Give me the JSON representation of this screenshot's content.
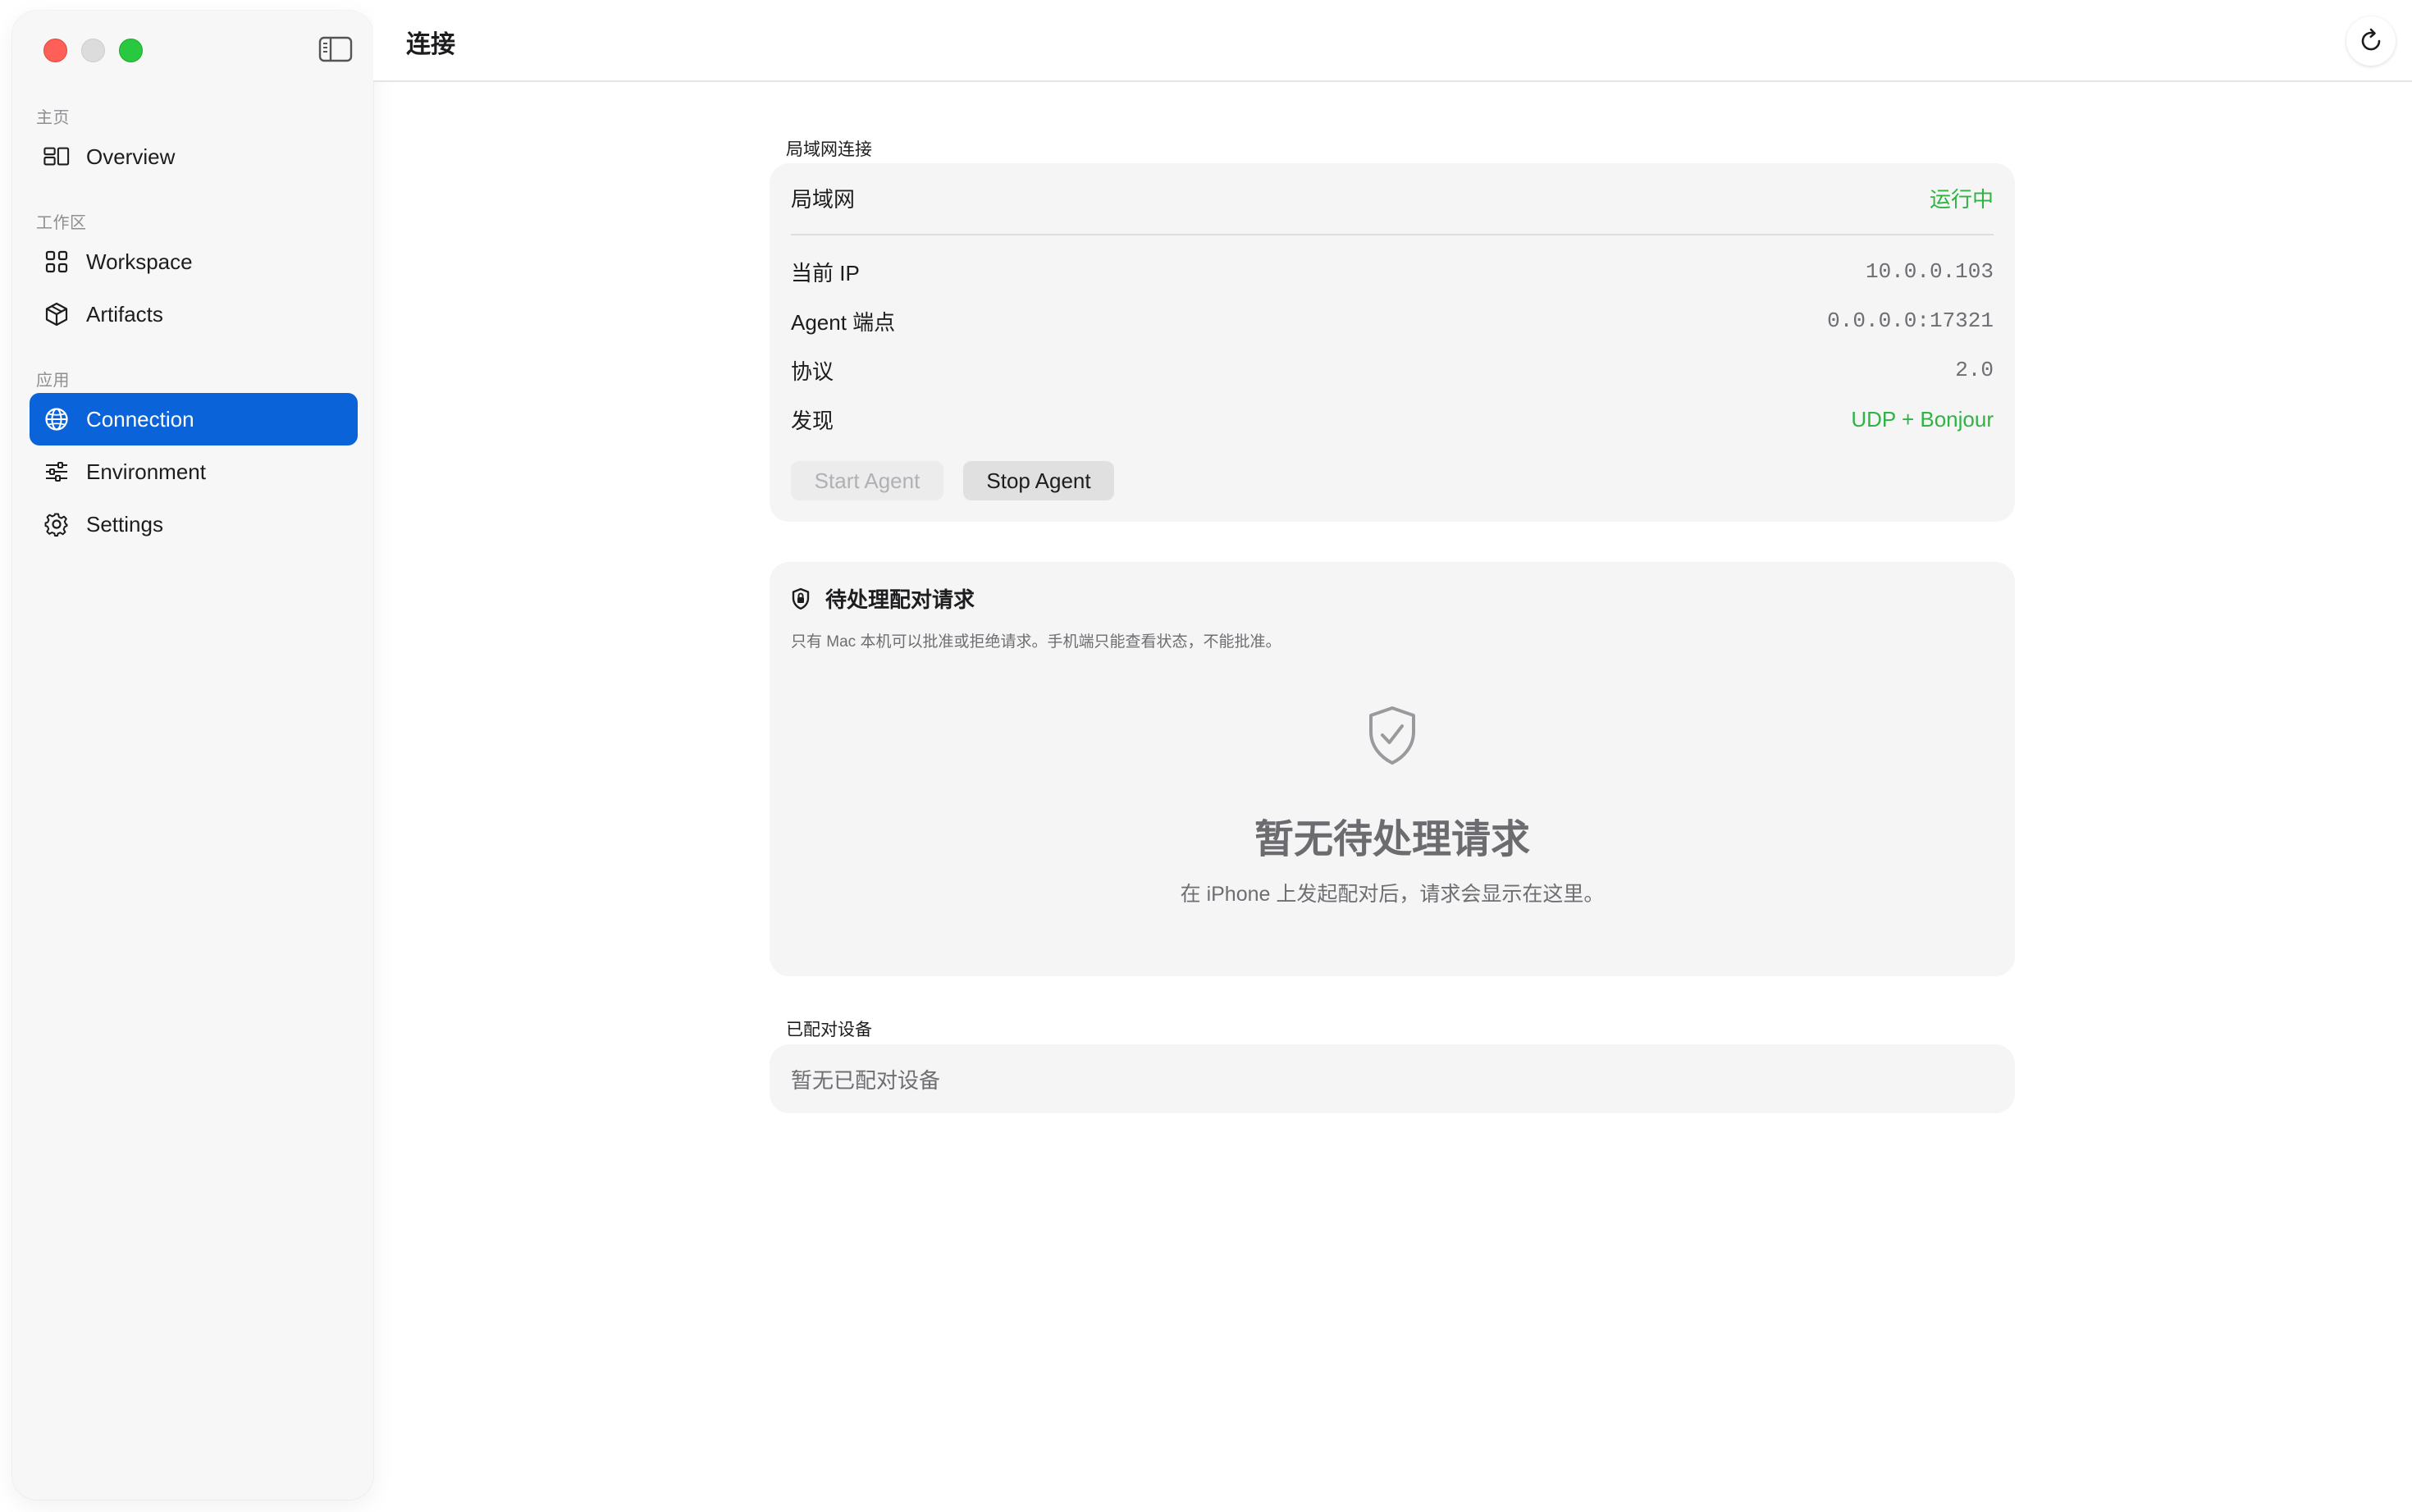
{
  "window": {
    "controls": [
      "close",
      "minimize",
      "zoom"
    ]
  },
  "sidebar": {
    "toggle_icon": "sidebar-left-icon",
    "sections": [
      {
        "label": "主页",
        "items": [
          {
            "label": "Overview",
            "icon": "overview-icon",
            "active": false
          }
        ]
      },
      {
        "label": "工作区",
        "items": [
          {
            "label": "Workspace",
            "icon": "grid-icon",
            "active": false
          },
          {
            "label": "Artifacts",
            "icon": "cube-icon",
            "active": false
          }
        ]
      },
      {
        "label": "应用",
        "items": [
          {
            "label": "Connection",
            "icon": "globe-icon",
            "active": true
          },
          {
            "label": "Environment",
            "icon": "sliders-icon",
            "active": false
          },
          {
            "label": "Settings",
            "icon": "gear-icon",
            "active": false
          }
        ]
      }
    ]
  },
  "header": {
    "title": "连接",
    "refresh_icon": "refresh-icon"
  },
  "lan": {
    "group_label": "局域网连接",
    "status_label": "局域网",
    "status_value": "运行中",
    "rows": [
      {
        "label": "当前 IP",
        "value": "10.0.0.103"
      },
      {
        "label": "Agent 端点",
        "value": "0.0.0.0:17321"
      },
      {
        "label": "协议",
        "value": "2.0"
      },
      {
        "label": "发现",
        "value": "UDP + Bonjour"
      }
    ],
    "start_button": "Start Agent",
    "stop_button": "Stop Agent"
  },
  "pending": {
    "title": "待处理配对请求",
    "subtitle": "只有 Mac 本机可以批准或拒绝请求。手机端只能查看状态，不能批准。",
    "empty_title": "暂无待处理请求",
    "empty_desc": "在 iPhone 上发起配对后，请求会显示在这里。"
  },
  "paired": {
    "group_label": "已配对设备",
    "empty_text": "暂无已配对设备"
  },
  "colors": {
    "accent": "#0a63d8",
    "status_green": "#2fb344"
  }
}
